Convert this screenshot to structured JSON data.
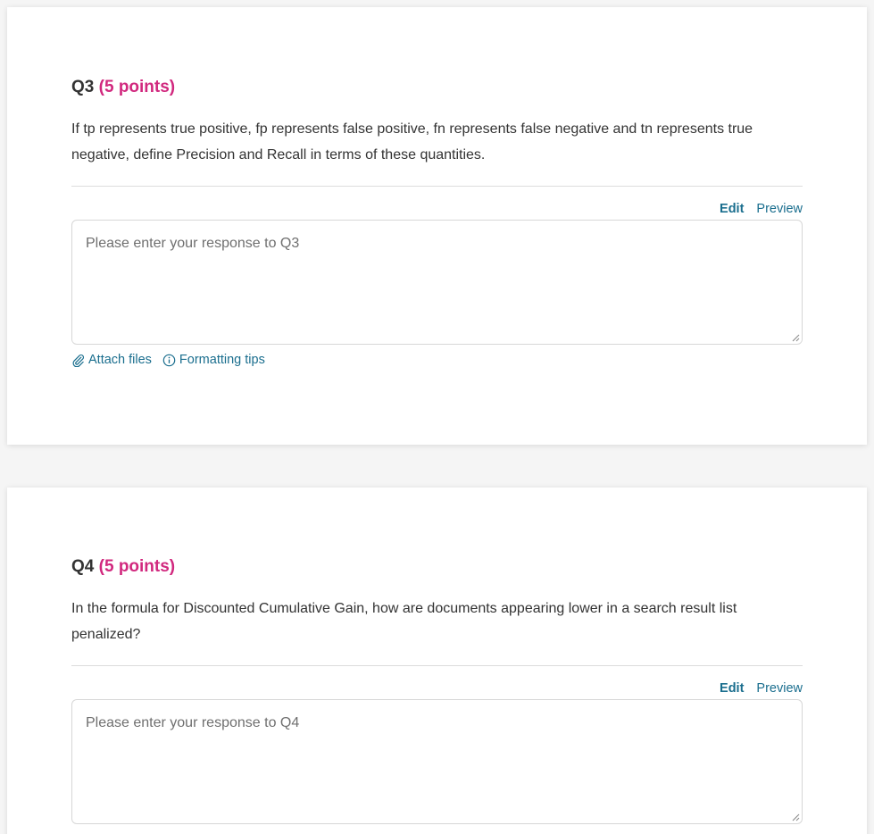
{
  "questions": [
    {
      "number": "Q3",
      "points": "(5 points)",
      "text": "If tp represents true positive, fp represents false positive, fn represents false negative and tn represents true negative, define Precision and Recall in terms of these quantities.",
      "edit_label": "Edit",
      "preview_label": "Preview",
      "placeholder": "Please enter your response to Q3",
      "attach_label": "Attach files",
      "formatting_label": "Formatting tips"
    },
    {
      "number": "Q4",
      "points": "(5 points)",
      "text": "In the formula for Discounted Cumulative Gain, how are documents appearing lower in a search result list penalized?",
      "edit_label": "Edit",
      "preview_label": "Preview",
      "placeholder": "Please enter your response to Q4"
    }
  ],
  "colors": {
    "points": "#d1287e",
    "link": "#1a6e8e",
    "text": "#333333"
  },
  "icons": {
    "attach": "paperclip-icon",
    "formatting": "info-circle-icon"
  }
}
